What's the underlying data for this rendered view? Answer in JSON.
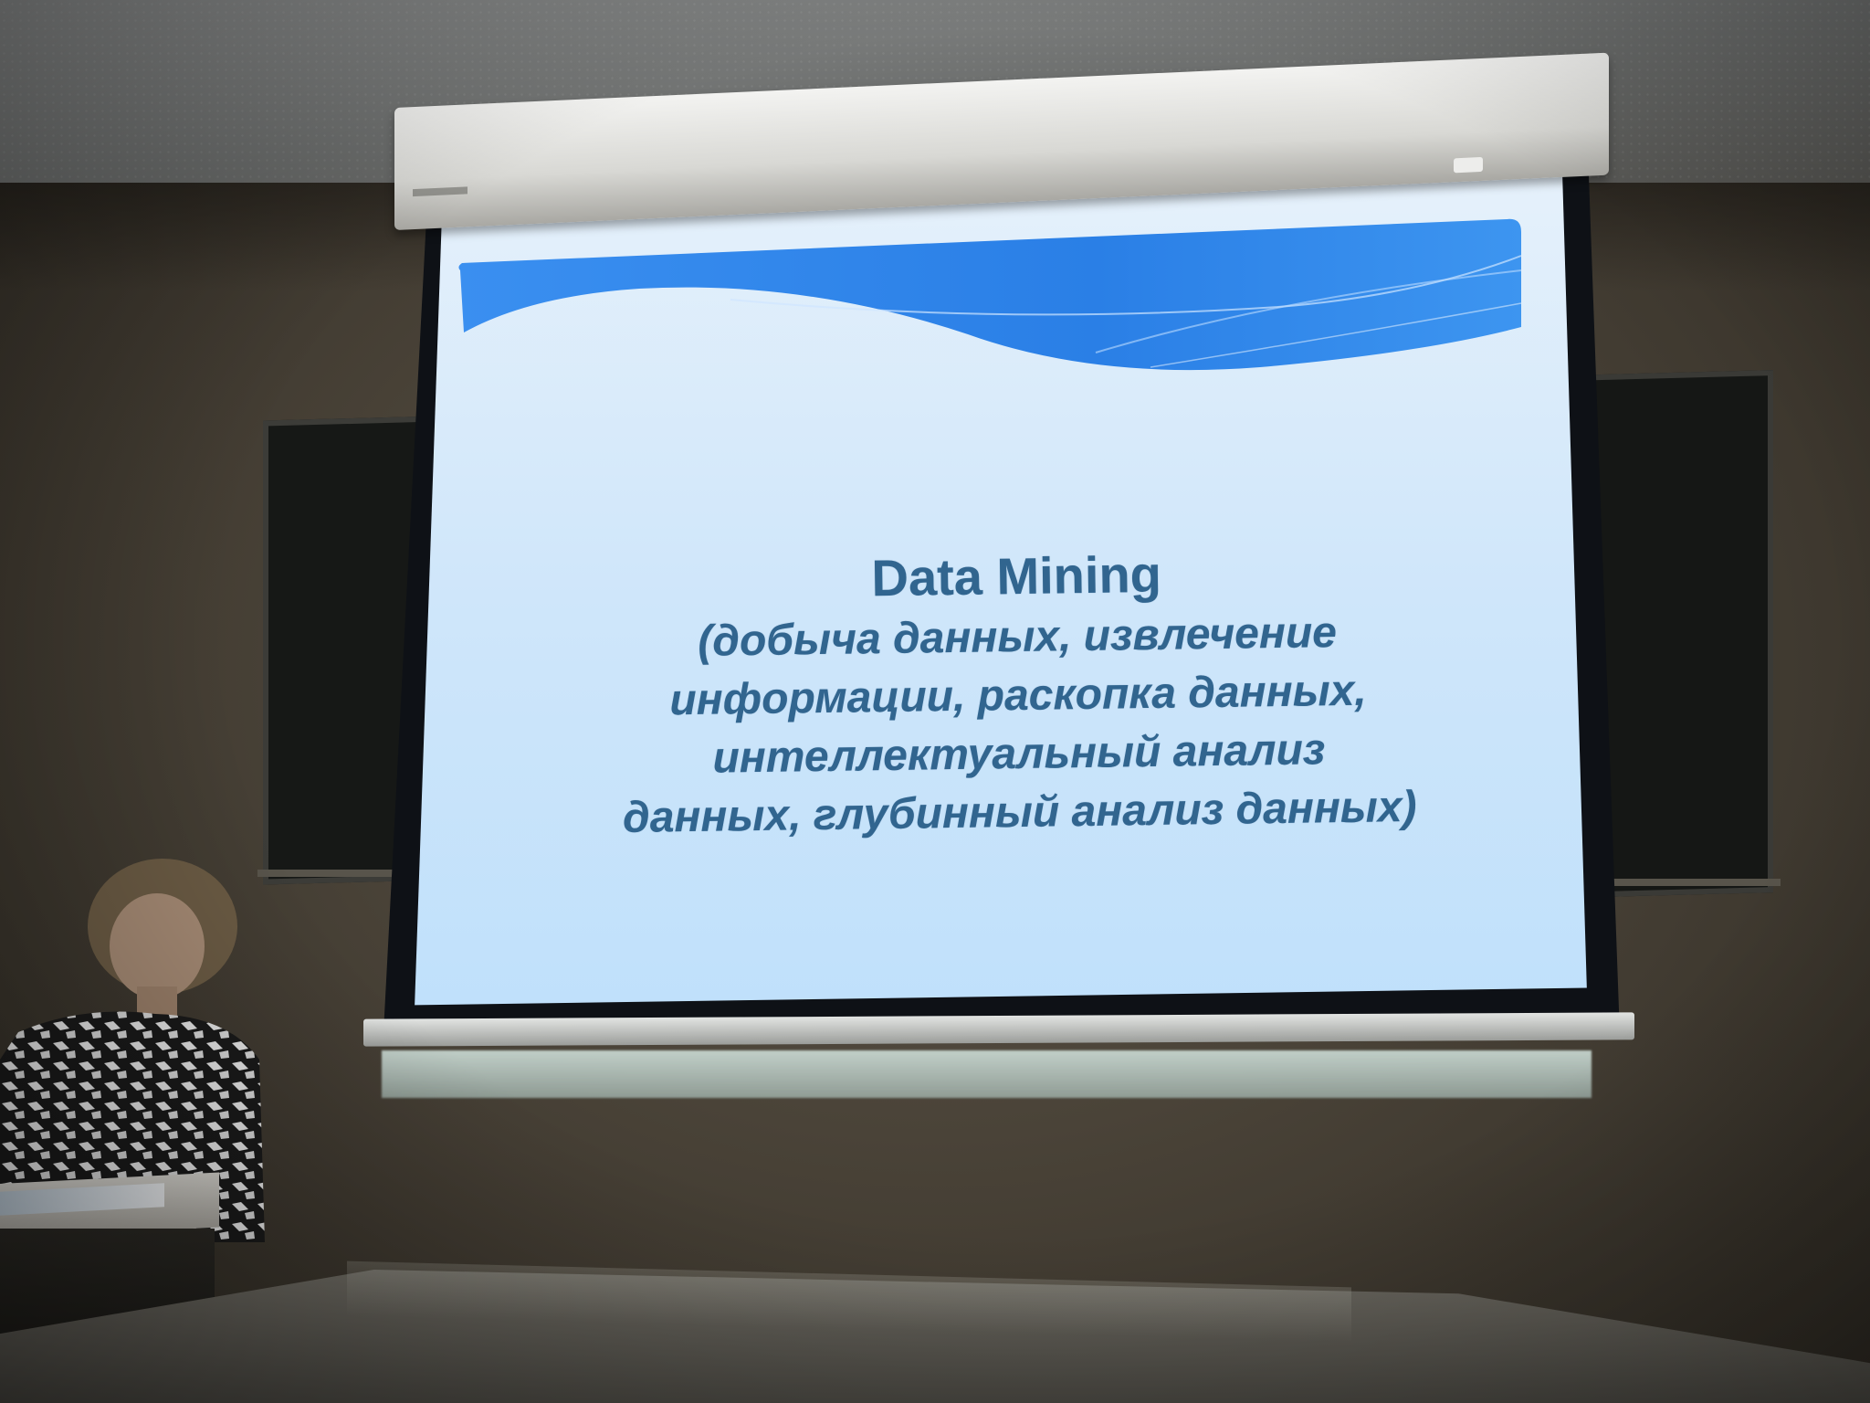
{
  "slide": {
    "title": "Data Mining",
    "lines": [
      "(добыча данных, извлечение",
      "информации, раскопка данных,",
      "интеллектуальный анализ",
      "данных, глубинный анализ данных)"
    ]
  },
  "colors": {
    "slide_text": "#31658f",
    "banner_blue": "#2f86ea",
    "screen_light": "#d7ebfb"
  }
}
